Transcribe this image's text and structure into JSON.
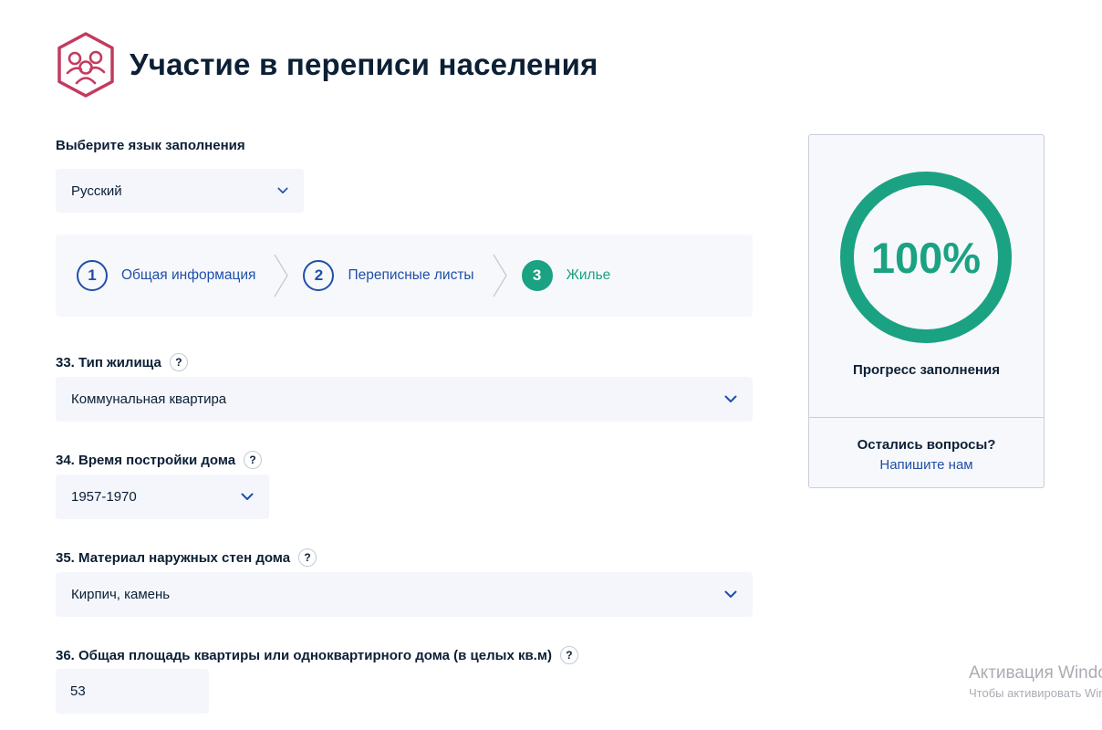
{
  "header": {
    "title": "Участие в переписи населения"
  },
  "language": {
    "label": "Выберите язык заполнения",
    "selected": "Русский"
  },
  "steps": [
    {
      "number": "1",
      "label": "Общая информация",
      "active": false
    },
    {
      "number": "2",
      "label": "Переписные листы",
      "active": false
    },
    {
      "number": "3",
      "label": "Жилье",
      "active": true
    }
  ],
  "questions": {
    "q33": {
      "label": "33. Тип жилища",
      "value": "Коммунальная квартира"
    },
    "q34": {
      "label": "34. Время постройки дома",
      "value": "1957-1970"
    },
    "q35": {
      "label": "35. Материал наружных стен дома",
      "value": "Кирпич, камень"
    },
    "q36": {
      "label": "36. Общая площадь квартиры или одноквартирного дома (в целых кв.м)",
      "value": "53"
    }
  },
  "help_glyph": "?",
  "progress": {
    "percent_text": "100%",
    "value": 1.0,
    "label": "Прогресс заполнения",
    "questions_label": "Остались вопросы?",
    "contact_link": "Напишите нам"
  },
  "watermark": {
    "title": "Активация Windows",
    "subtitle": "Чтобы активировать Windows"
  },
  "colors": {
    "primary": "#1f4fa8",
    "accent": "#1aa283",
    "logo": "#c43a5e",
    "text": "#0b1f35",
    "field_bg": "#f4f6fb"
  }
}
